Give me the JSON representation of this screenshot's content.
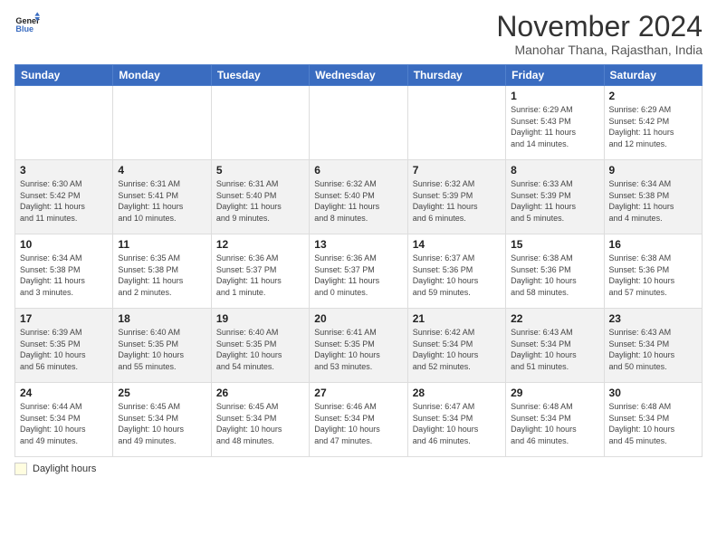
{
  "header": {
    "logo_line1": "General",
    "logo_line2": "Blue",
    "title": "November 2024",
    "subtitle": "Manohar Thana, Rajasthan, India"
  },
  "legend": {
    "label": "Daylight hours"
  },
  "days_of_week": [
    "Sunday",
    "Monday",
    "Tuesday",
    "Wednesday",
    "Thursday",
    "Friday",
    "Saturday"
  ],
  "weeks": [
    [
      {
        "day": "",
        "info": ""
      },
      {
        "day": "",
        "info": ""
      },
      {
        "day": "",
        "info": ""
      },
      {
        "day": "",
        "info": ""
      },
      {
        "day": "",
        "info": ""
      },
      {
        "day": "1",
        "info": "Sunrise: 6:29 AM\nSunset: 5:43 PM\nDaylight: 11 hours\nand 14 minutes."
      },
      {
        "day": "2",
        "info": "Sunrise: 6:29 AM\nSunset: 5:42 PM\nDaylight: 11 hours\nand 12 minutes."
      }
    ],
    [
      {
        "day": "3",
        "info": "Sunrise: 6:30 AM\nSunset: 5:42 PM\nDaylight: 11 hours\nand 11 minutes."
      },
      {
        "day": "4",
        "info": "Sunrise: 6:31 AM\nSunset: 5:41 PM\nDaylight: 11 hours\nand 10 minutes."
      },
      {
        "day": "5",
        "info": "Sunrise: 6:31 AM\nSunset: 5:40 PM\nDaylight: 11 hours\nand 9 minutes."
      },
      {
        "day": "6",
        "info": "Sunrise: 6:32 AM\nSunset: 5:40 PM\nDaylight: 11 hours\nand 8 minutes."
      },
      {
        "day": "7",
        "info": "Sunrise: 6:32 AM\nSunset: 5:39 PM\nDaylight: 11 hours\nand 6 minutes."
      },
      {
        "day": "8",
        "info": "Sunrise: 6:33 AM\nSunset: 5:39 PM\nDaylight: 11 hours\nand 5 minutes."
      },
      {
        "day": "9",
        "info": "Sunrise: 6:34 AM\nSunset: 5:38 PM\nDaylight: 11 hours\nand 4 minutes."
      }
    ],
    [
      {
        "day": "10",
        "info": "Sunrise: 6:34 AM\nSunset: 5:38 PM\nDaylight: 11 hours\nand 3 minutes."
      },
      {
        "day": "11",
        "info": "Sunrise: 6:35 AM\nSunset: 5:38 PM\nDaylight: 11 hours\nand 2 minutes."
      },
      {
        "day": "12",
        "info": "Sunrise: 6:36 AM\nSunset: 5:37 PM\nDaylight: 11 hours\nand 1 minute."
      },
      {
        "day": "13",
        "info": "Sunrise: 6:36 AM\nSunset: 5:37 PM\nDaylight: 11 hours\nand 0 minutes."
      },
      {
        "day": "14",
        "info": "Sunrise: 6:37 AM\nSunset: 5:36 PM\nDaylight: 10 hours\nand 59 minutes."
      },
      {
        "day": "15",
        "info": "Sunrise: 6:38 AM\nSunset: 5:36 PM\nDaylight: 10 hours\nand 58 minutes."
      },
      {
        "day": "16",
        "info": "Sunrise: 6:38 AM\nSunset: 5:36 PM\nDaylight: 10 hours\nand 57 minutes."
      }
    ],
    [
      {
        "day": "17",
        "info": "Sunrise: 6:39 AM\nSunset: 5:35 PM\nDaylight: 10 hours\nand 56 minutes."
      },
      {
        "day": "18",
        "info": "Sunrise: 6:40 AM\nSunset: 5:35 PM\nDaylight: 10 hours\nand 55 minutes."
      },
      {
        "day": "19",
        "info": "Sunrise: 6:40 AM\nSunset: 5:35 PM\nDaylight: 10 hours\nand 54 minutes."
      },
      {
        "day": "20",
        "info": "Sunrise: 6:41 AM\nSunset: 5:35 PM\nDaylight: 10 hours\nand 53 minutes."
      },
      {
        "day": "21",
        "info": "Sunrise: 6:42 AM\nSunset: 5:34 PM\nDaylight: 10 hours\nand 52 minutes."
      },
      {
        "day": "22",
        "info": "Sunrise: 6:43 AM\nSunset: 5:34 PM\nDaylight: 10 hours\nand 51 minutes."
      },
      {
        "day": "23",
        "info": "Sunrise: 6:43 AM\nSunset: 5:34 PM\nDaylight: 10 hours\nand 50 minutes."
      }
    ],
    [
      {
        "day": "24",
        "info": "Sunrise: 6:44 AM\nSunset: 5:34 PM\nDaylight: 10 hours\nand 49 minutes."
      },
      {
        "day": "25",
        "info": "Sunrise: 6:45 AM\nSunset: 5:34 PM\nDaylight: 10 hours\nand 49 minutes."
      },
      {
        "day": "26",
        "info": "Sunrise: 6:45 AM\nSunset: 5:34 PM\nDaylight: 10 hours\nand 48 minutes."
      },
      {
        "day": "27",
        "info": "Sunrise: 6:46 AM\nSunset: 5:34 PM\nDaylight: 10 hours\nand 47 minutes."
      },
      {
        "day": "28",
        "info": "Sunrise: 6:47 AM\nSunset: 5:34 PM\nDaylight: 10 hours\nand 46 minutes."
      },
      {
        "day": "29",
        "info": "Sunrise: 6:48 AM\nSunset: 5:34 PM\nDaylight: 10 hours\nand 46 minutes."
      },
      {
        "day": "30",
        "info": "Sunrise: 6:48 AM\nSunset: 5:34 PM\nDaylight: 10 hours\nand 45 minutes."
      }
    ]
  ]
}
